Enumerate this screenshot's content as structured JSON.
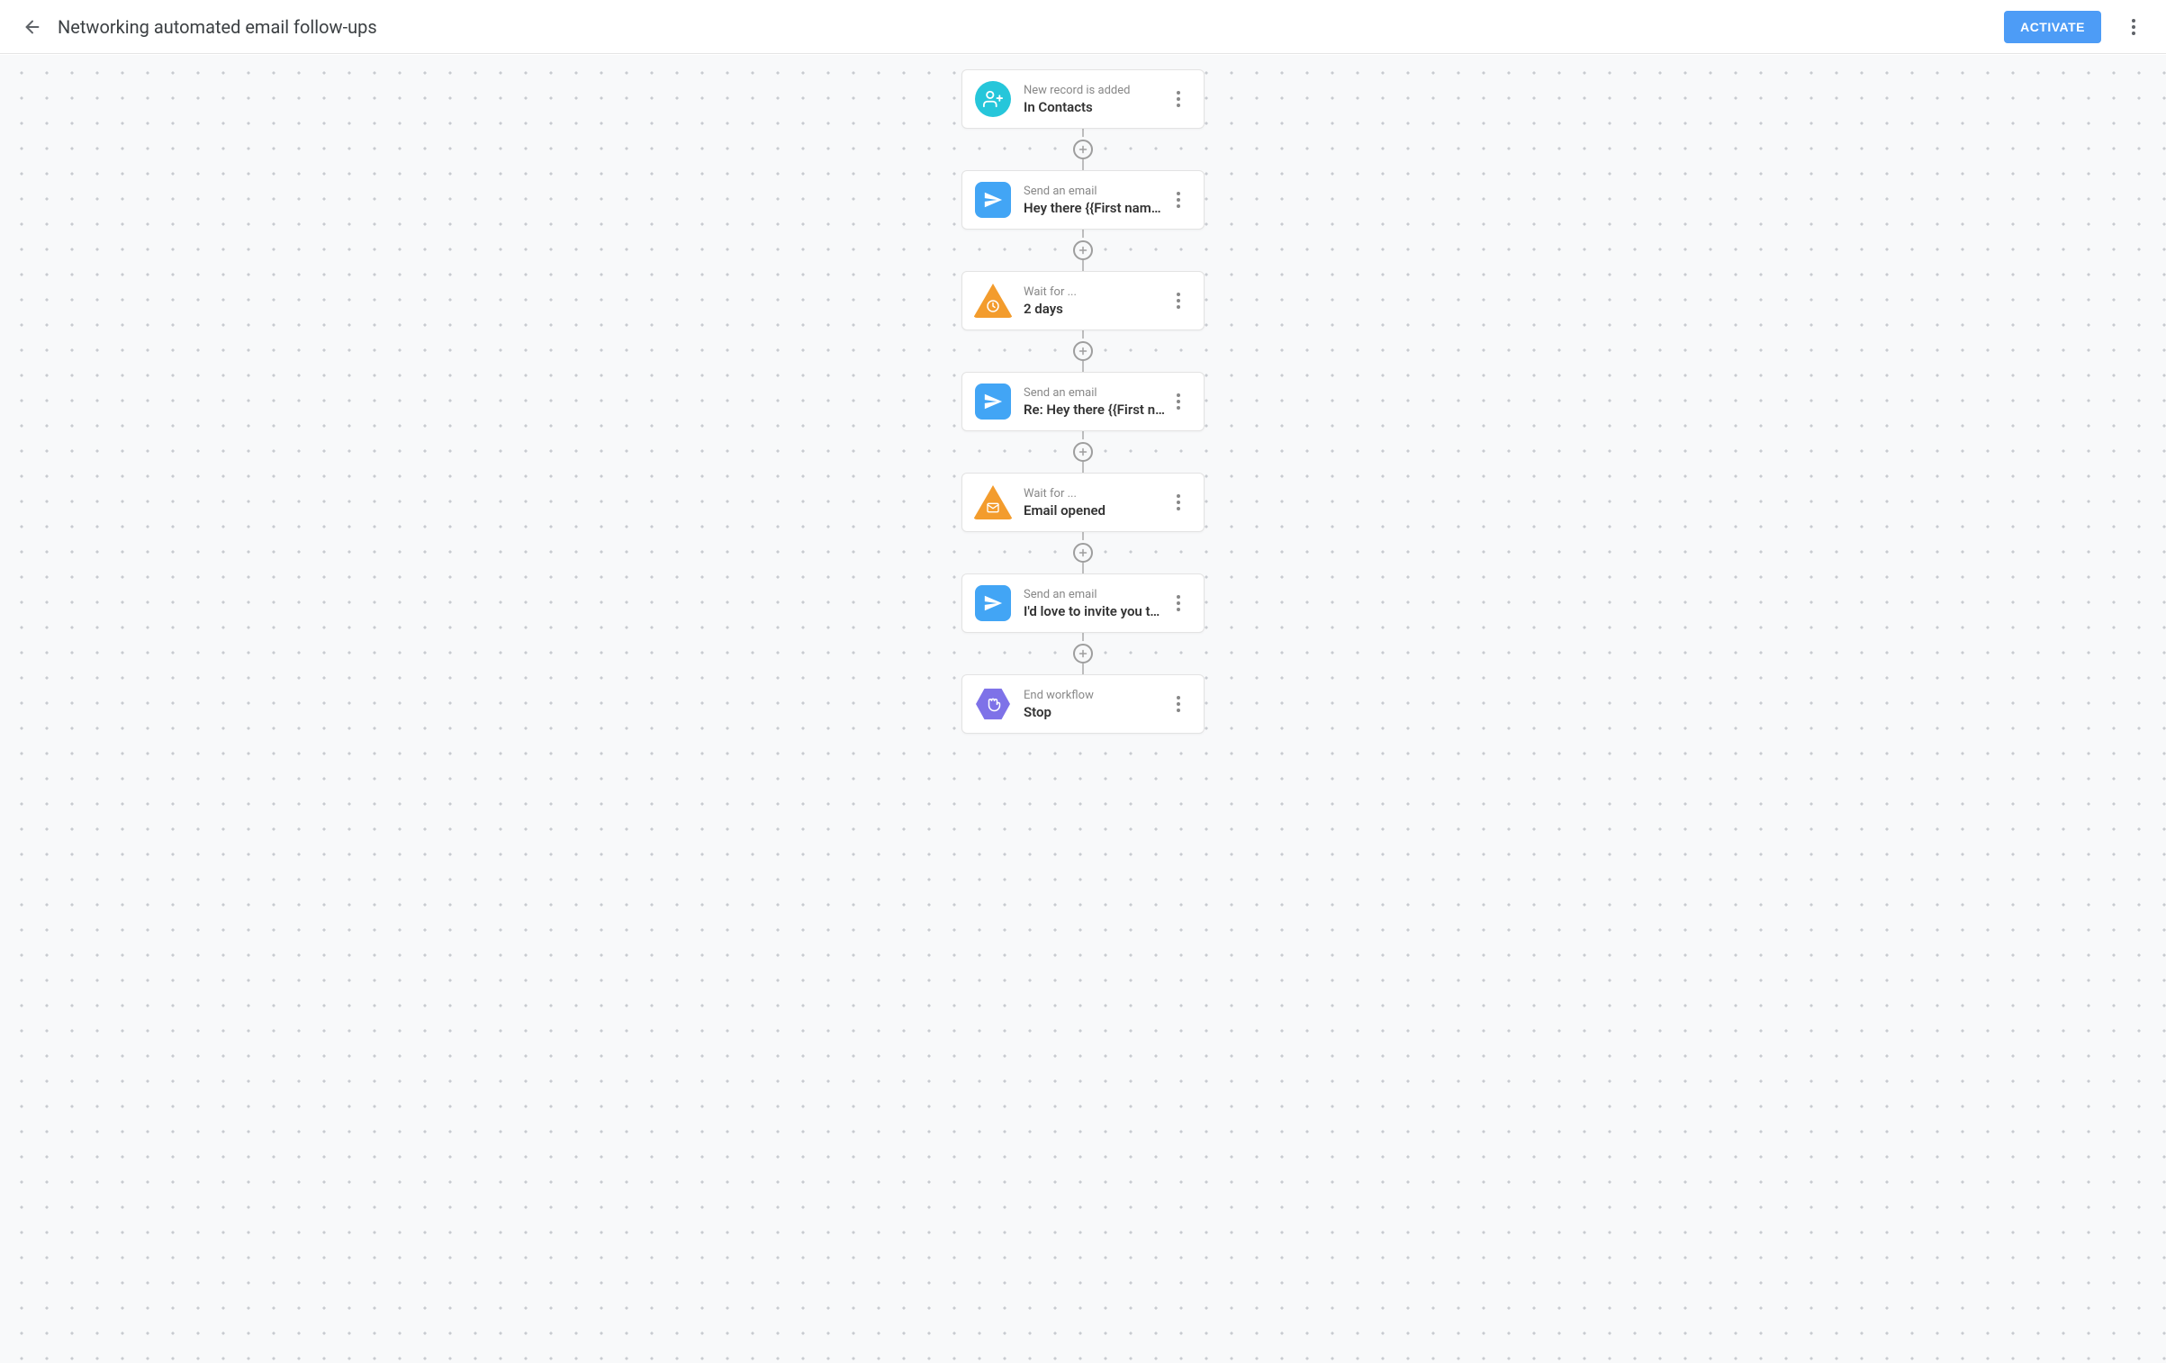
{
  "header": {
    "title": "Networking automated email follow-ups",
    "activate_label": "ACTIVATE"
  },
  "nodes": [
    {
      "icon": "person-add-circle",
      "label": "New record is added",
      "detail": "In Contacts"
    },
    {
      "icon": "send-square",
      "label": "Send an email",
      "detail": "Hey there {{First name…"
    },
    {
      "icon": "clock-triangle",
      "label": "Wait for ...",
      "detail": "2 days"
    },
    {
      "icon": "send-square",
      "label": "Send an email",
      "detail": "Re: Hey there {{First n…"
    },
    {
      "icon": "mail-triangle",
      "label": "Wait for ...",
      "detail": "Email opened"
    },
    {
      "icon": "send-square",
      "label": "Send an email",
      "detail": "I'd love to invite you to…"
    },
    {
      "icon": "stop-hexagon",
      "label": "End workflow",
      "detail": "Stop"
    }
  ]
}
